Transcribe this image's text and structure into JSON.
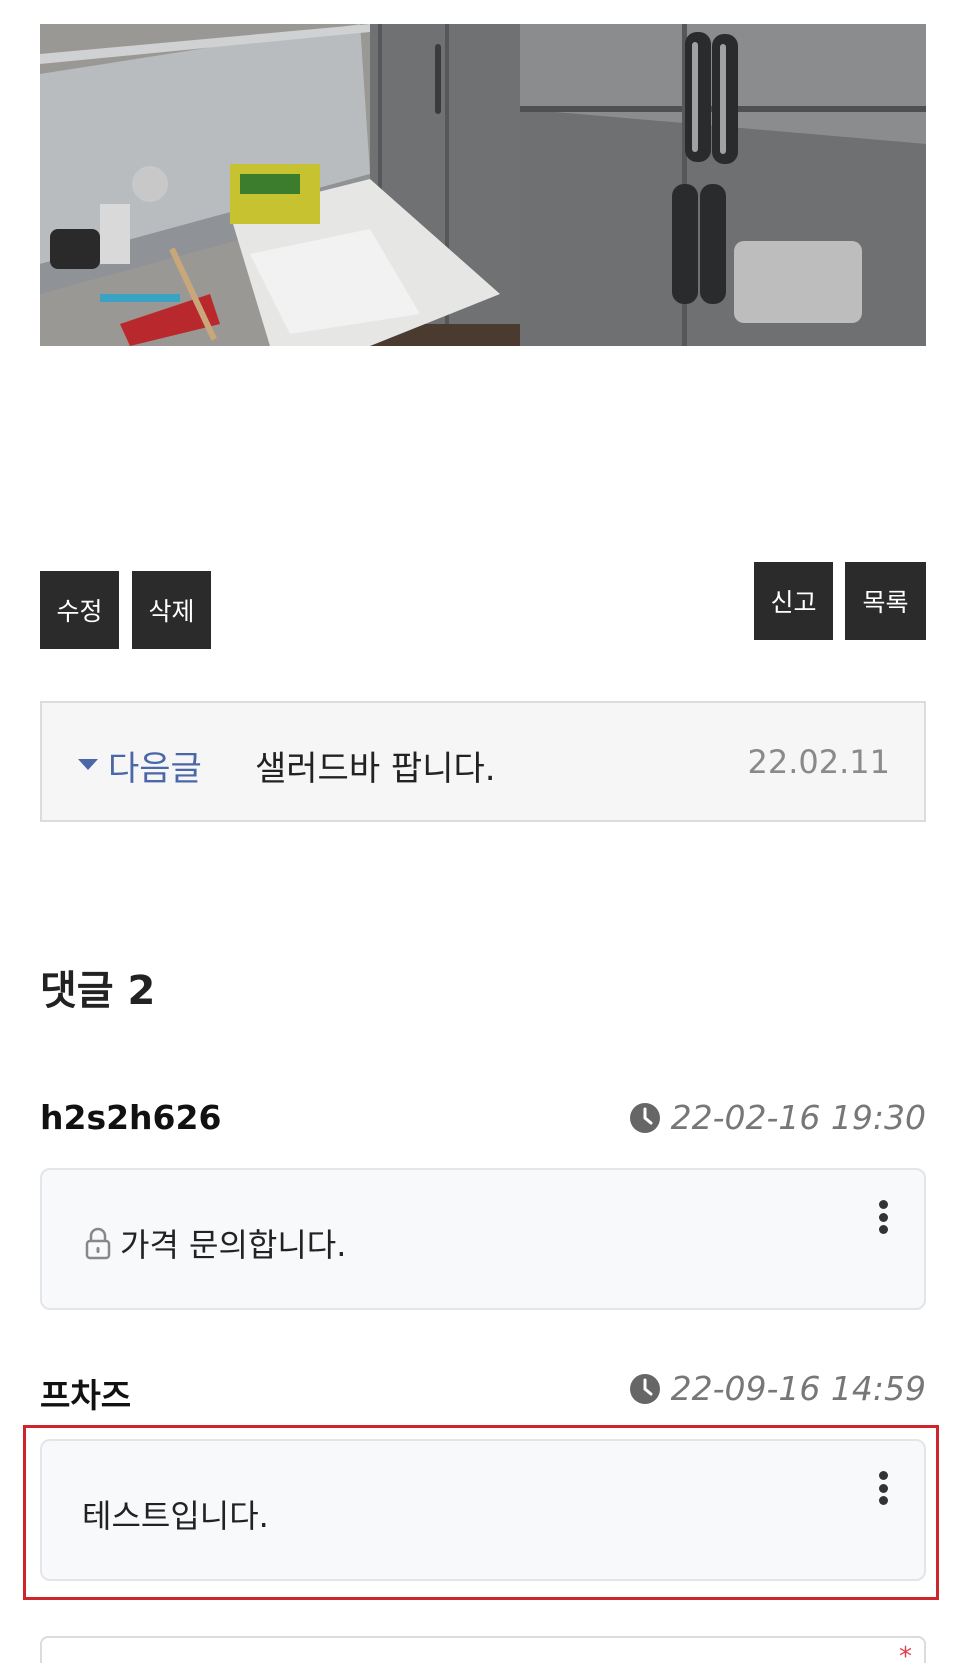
{
  "post": {
    "image_alt": "주방 냉장고 사진"
  },
  "actions": {
    "edit_label": "수정",
    "delete_label": "삭제",
    "report_label": "신고",
    "list_label": "목록"
  },
  "next_post": {
    "label": "다음글",
    "title": "샐러드바 팝니다.",
    "date": "22.02.11"
  },
  "comments": {
    "header": "댓글 2",
    "items": [
      {
        "author": "h2s2h626",
        "time": "22-02-16 19:30",
        "text": "가격 문의합니다.",
        "secret": true
      },
      {
        "author": "프차즈",
        "time": "22-09-16 14:59",
        "text": "테스트입니다.",
        "secret": false
      }
    ]
  },
  "comment_form": {
    "required_mark": "*"
  },
  "colors": {
    "accent": "#4a67a8",
    "highlight": "#d0242b",
    "button_bg": "#2b2b2b"
  }
}
